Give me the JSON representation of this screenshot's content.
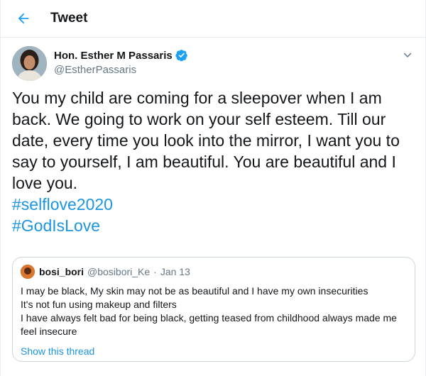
{
  "header": {
    "title": "Tweet",
    "back_icon": "arrow-left-icon",
    "accent": "#1da1f2"
  },
  "tweet": {
    "author_name": "Hon. Esther M Passaris",
    "author_handle": "@EstherPassaris",
    "verified_icon": "verified-badge-icon",
    "text": "You my child are coming for a sleepover when I am back. We going to work on your self esteem. Till our date, every time you look into the mirror, I  want you to say to yourself, I am beautiful. You are beautiful and I love you.",
    "hashtags": [
      "#selflove2020",
      "#GodIsLove"
    ],
    "hashtag_color": "#1b95e0"
  },
  "quote": {
    "author_name": "bosi_bori",
    "author_handle": "@bosibori_Ke",
    "separator": "·",
    "date": "Jan 13",
    "lines": [
      "I may be black, My skin may not be as beautiful and I have my own insecurities",
      "It's not fun using makeup and filters",
      "I have always felt bad for being black, getting teased from childhood always made me feel insecure"
    ],
    "show_thread": "Show this thread"
  }
}
